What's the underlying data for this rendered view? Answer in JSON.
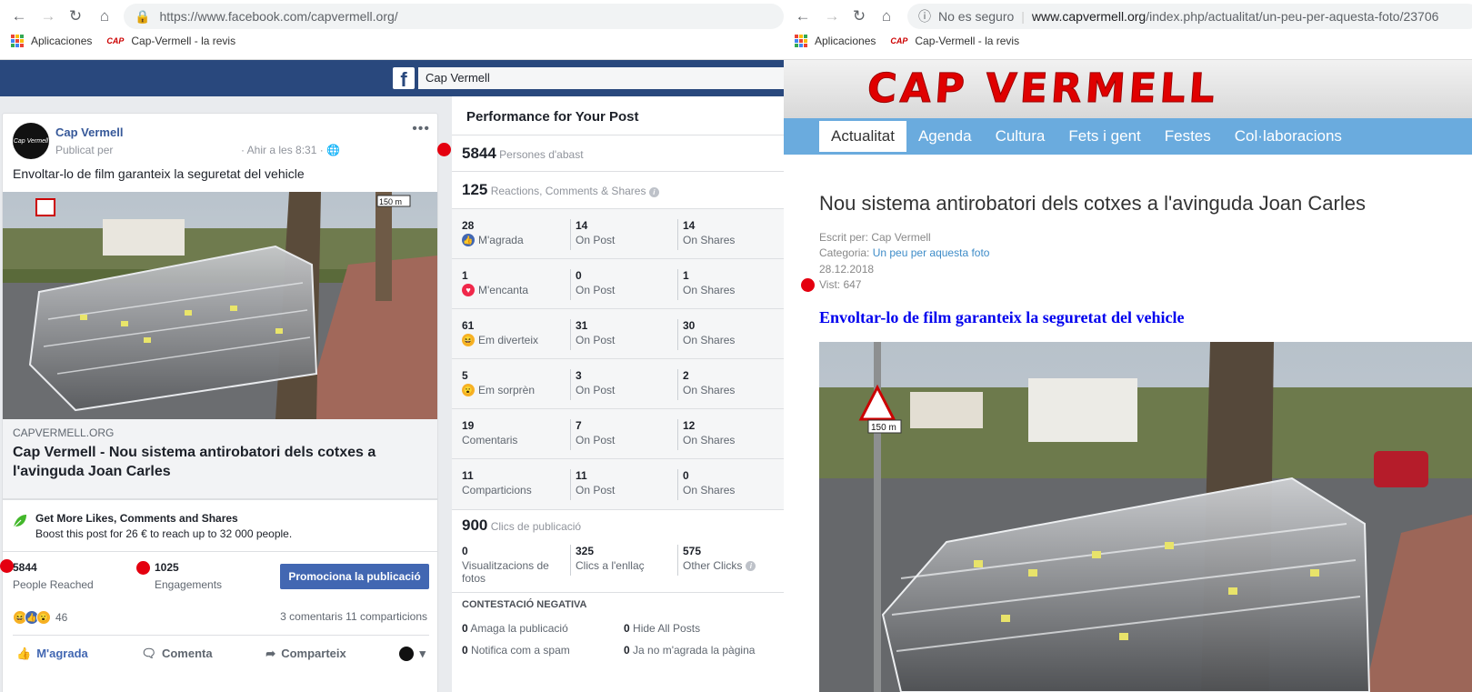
{
  "left_browser": {
    "url_host": "https://www.facebook.com",
    "url_path": "/capvermell.org/",
    "bookmarks": [
      "Aplicaciones",
      "Cap-Vermell - la revis"
    ],
    "bookmark_favicon": "CAP"
  },
  "fb": {
    "logo": "f",
    "search_value": "Cap Vermell"
  },
  "post": {
    "page_name": "Cap Vermell",
    "avatar_text": "Cap Vermell",
    "published": "Publicat per",
    "time": "· Ahir a les 8:31 ·",
    "menu": "•••",
    "text": "Envoltar-lo de film garanteix la seguretat del vehicle",
    "link_domain": "CAPVERMELL.ORG",
    "link_title": "Cap Vermell - Nou sistema antirobatori dels cotxes a l'avinguda Joan Carles",
    "boost_title": "Get More Likes, Comments and Shares",
    "boost_desc": "Boost this post for 26 € to reach up to 32 000 people.",
    "people_reached": "5844",
    "people_reached_label": "People Reached",
    "engagements": "1025",
    "engagements_label": "Engagements",
    "promote_button": "Promociona la publicació",
    "reactions_count": "46",
    "comments_shares": "3 comentaris   11 comparticions",
    "actions": {
      "like": "M'agrada",
      "comment": "Comenta",
      "share": "Comparteix"
    },
    "sign_stop": "150 m"
  },
  "perf": {
    "title": "Performance for Your Post",
    "reach_num": "5844",
    "reach_label": "Persones d'abast",
    "eng_num": "125",
    "eng_label": "Reactions, Comments & Shares",
    "rows": [
      {
        "n1": "28",
        "l1": "M'agrada",
        "n2": "14",
        "l2": "On Post",
        "n3": "14",
        "l3": "On Shares"
      },
      {
        "n1": "1",
        "l1": "M'encanta",
        "n2": "0",
        "l2": "On Post",
        "n3": "1",
        "l3": "On Shares"
      },
      {
        "n1": "61",
        "l1": "Em diverteix",
        "n2": "31",
        "l2": "On Post",
        "n3": "30",
        "l3": "On Shares"
      },
      {
        "n1": "5",
        "l1": "Em sorprèn",
        "n2": "3",
        "l2": "On Post",
        "n3": "2",
        "l3": "On Shares"
      },
      {
        "n1": "19",
        "l1": "Comentaris",
        "n2": "7",
        "l2": "On Post",
        "n3": "12",
        "l3": "On Shares"
      },
      {
        "n1": "11",
        "l1": "Comparticions",
        "n2": "11",
        "l2": "On Post",
        "n3": "0",
        "l3": "On Shares"
      }
    ],
    "clicks_num": "900",
    "clicks_label": "Clics de publicació",
    "click_cells": {
      "n1": "0",
      "l1": "Visualitzacions de fotos",
      "n2": "325",
      "l2": "Clics a l'enllaç",
      "n3": "575",
      "l3": "Other Clicks"
    },
    "neg_heading": "CONTESTACIÓ NEGATIVA",
    "neg": {
      "hide_num": "0",
      "hide": "Amaga la publicació",
      "hideall_num": "0",
      "hideall": "Hide All Posts",
      "spam_num": "0",
      "spam": "Notifica com a spam",
      "unlike_num": "0",
      "unlike": "Ja no m'agrada la pàgina"
    }
  },
  "right_browser": {
    "security": "No es seguro",
    "url_host": "www.capvermell.org",
    "url_path": "/index.php/actualitat/un-peu-per-aquesta-foto/23706",
    "bookmarks": [
      "Aplicaciones",
      "Cap-Vermell - la revis"
    ],
    "bookmark_favicon": "CAP"
  },
  "site": {
    "logo": "CAP VERMELL",
    "nav": [
      "Actualitat",
      "Agenda",
      "Cultura",
      "Fets i gent",
      "Festes",
      "Col·laboracions"
    ],
    "article_title": "Nou sistema antirobatori dels cotxes a l'avinguda Joan Carles",
    "author_label": "Escrit per: Cap Vermell",
    "category_label": "Categoria: ",
    "category_link": "Un peu per aquesta foto",
    "date": "28.12.2018",
    "views": "Vist: 647",
    "subtitle": "Envoltar-lo de film garanteix la seguretat del vehicle",
    "sign_stop": "150 m"
  },
  "colors": {
    "fb_blue": "#29487d",
    "link_blue": "#365899",
    "promo_blue": "#4267b2",
    "site_nav": "#6aabde",
    "marker_red": "#e4000f"
  }
}
